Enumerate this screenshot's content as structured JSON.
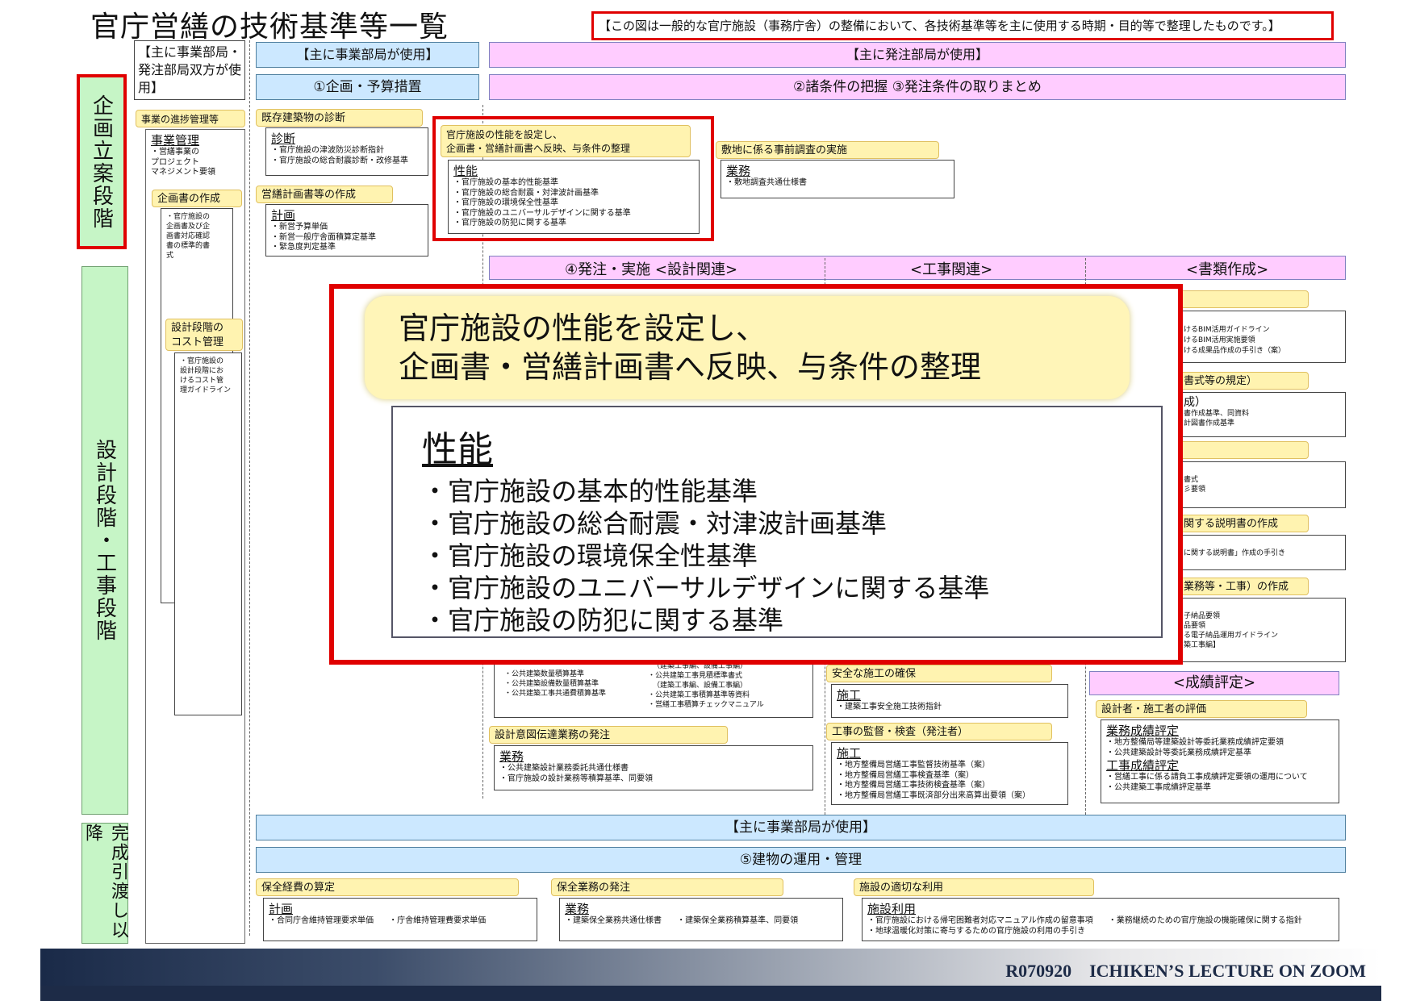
{
  "title": "官庁営繕の技術基準等一覧",
  "note": "【この図は一般的な官庁施設（事務庁舎）の整備において、各技術基準等を主に使用する時期・目的等で整理したものです。】",
  "headers": {
    "both_use": "【主に事業部局・発注部局双方が使用】",
    "jigyo_use": "【主に事業部局が使用】",
    "hacchu_use": "【主に発注部局が使用】",
    "kikaku": "①企画・予算措置",
    "shojoken": "②諸条件の把握 ③発注条件の取りまとめ",
    "hacchu_jisshi": "④発注・実施 <設計関連>",
    "koji": "<工事関連>",
    "shorui": "<書類作成>",
    "seiseki": "<成績評定>",
    "jigyo_use2": "【主に事業部局が使用】",
    "unyo": "⑤建物の運用・管理"
  },
  "phases": {
    "kikaku": "企画立案段階",
    "sekkei": "設計段階・工事段階",
    "kansei": "完成引渡し以降"
  },
  "left_col": {
    "tab1": "事業の進捗管理等",
    "box1_head": "事業管理",
    "box1_lines": [
      "・営繕事業の",
      "プロジェクト",
      "マネジメント要領"
    ],
    "tab2": "企画書の作成",
    "box2_lines": [
      "・官庁施設の",
      "企画書及び企",
      "画書対応確認",
      "書の標準的書",
      "式"
    ],
    "tab3": "設計段階の",
    "tab3b": "コスト管理",
    "box3_lines": [
      "・官庁施設の",
      "設計段階にお",
      "けるコスト管",
      "理ガイドライン"
    ]
  },
  "kikaku_col": {
    "tab1": "既存建築物の診断",
    "box1_head": "診断",
    "box1_lines": [
      "・官庁施設の津波防災診断指針",
      "・官庁施設の総合耐震診断・改修基準"
    ],
    "tab2": "営繕計画書等の作成",
    "box2_head": "計画",
    "box2_lines": [
      "・新営予算単価",
      "・新営一般庁舎面積算定基準",
      "・緊急度判定基準"
    ]
  },
  "seino": {
    "tab": "官庁施設の性能を設定し、企画書・営繕計画書へ反映、与条件の整理",
    "tab_l1": "官庁施設の性能を設定し、",
    "tab_l2": "企画書・営繕計画書へ反映、与条件の整理",
    "head": "性能",
    "lines": [
      "・官庁施設の基本的性能基準",
      "・官庁施設の総合耐震・対津波計画基準",
      "・官庁施設の環境保全性基準",
      "・官庁施設のユニバーサルデザインに関する基準",
      "・官庁施設の防犯に関する基準"
    ]
  },
  "shikichi": {
    "tab": "敷地に係る事前調査の実施",
    "head": "業務",
    "lines": [
      "・敷地調査共通仕様書"
    ]
  },
  "right_partial": {
    "l1": "けるBIM活用ガイドライン",
    "l2": "けるBIM活用実施要領",
    "l3": "ける成果品作成の手引き（案）",
    "t2": "書式等の規定）",
    "h2": "成）",
    "l4": "書作成基準、同資料",
    "l5": "計図書作成基準",
    "l6": "書式",
    "l7": "彡要領",
    "t3": "関する説明書の作成",
    "l8": "に関する説明書」作成の手引き",
    "t4": "業務等・工事）の作成",
    "l9": "子納品要領",
    "l10": "品要領",
    "l11": "る電子納品運用ガイドライン",
    "l12": "築工事編】"
  },
  "sekisan_partial": {
    "l1": "・公共建築数量積算基準",
    "l2": "・公共建築設備数量積算基準",
    "l3": "・公共建築工事共通費積算基準",
    "r0": "（建築工事編、設備工事編）",
    "r1": "・公共建築工事見積標準書式",
    "r2": "（建築工事編、設備工事編）",
    "r3": "・公共建築工事積算基準等資料",
    "r4": "・営繕工事積算チェックマニュアル"
  },
  "sekkei_ito": {
    "tab": "設計意図伝達業務の発注",
    "head": "業務",
    "lines": [
      "・公共建築設計業務委託共通仕様書",
      "・官庁施設の設計業務等積算基準、同要領"
    ]
  },
  "anzen": {
    "tab": "安全な施工の確保",
    "head": "施工",
    "lines": [
      "・建築工事安全施工技術指針"
    ]
  },
  "kantoku": {
    "tab": "工事の監督・検査（発注者）",
    "head": "施工",
    "lines": [
      "・地方整備局営繕工事監督技術基準（案）",
      "・地方整備局営繕工事検査基準（案）",
      "・地方整備局営繕工事技術検査基準（案）",
      "・地方整備局営繕工事既済部分出来高算出要領（案）"
    ]
  },
  "hyoka": {
    "tab": "設計者・施工者の評価",
    "head1": "業務成績評定",
    "lines1": [
      "・地方整備局等建築設計等委託業務成績評定要領",
      "・公共建築設計等委託業務成績評定基準"
    ],
    "head2": "工事成績評定",
    "lines2": [
      "・営繕工事に係る請負工事成績評定要領の運用について",
      "・公共建築工事成績評定基準"
    ]
  },
  "bottom": {
    "tab1": "保全経費の算定",
    "box1_head": "計画",
    "box1_a": "・合同庁舎維持管理要求単価",
    "box1_b": "・庁舎維持管理費要求単価",
    "tab2": "保全業務の発注",
    "box2_head": "業務",
    "box2_a": "・建築保全業務共通仕様書",
    "box2_b": "・建築保全業務積算基準、同要領",
    "tab3": "施設の適切な利用",
    "box3_head": "施設利用",
    "box3_a": "・官庁施設における帰宅困難者対応マニュアル作成の留意事項",
    "box3_b": "・地球温暖化対策に寄与するための官庁施設の利用の手引き",
    "box3_c": "・業務継続のための官庁施設の機能確保に関する指針"
  },
  "zoom": {
    "title_l1": "官庁施設の性能を設定し、",
    "title_l2": "企画書・営繕計画書へ反映、与条件の整理",
    "head": "性能",
    "lines": [
      "・官庁施設の基本的性能基準",
      "・官庁施設の総合耐震・対津波計画基準",
      "・官庁施設の環境保全性基準",
      "・官庁施設のユニバーサルデザインに関する基準",
      "・官庁施設の防犯に関する基準"
    ]
  },
  "footer": "R070920　ICHIKEN’S LECTURE ON ZOOM",
  "colors": {
    "pink": "#ffccff",
    "blue": "#cce8ff",
    "green": "#c6f5c6",
    "tab": "#fff3b0",
    "red": "#e00000",
    "footer": "#1d2b47"
  }
}
